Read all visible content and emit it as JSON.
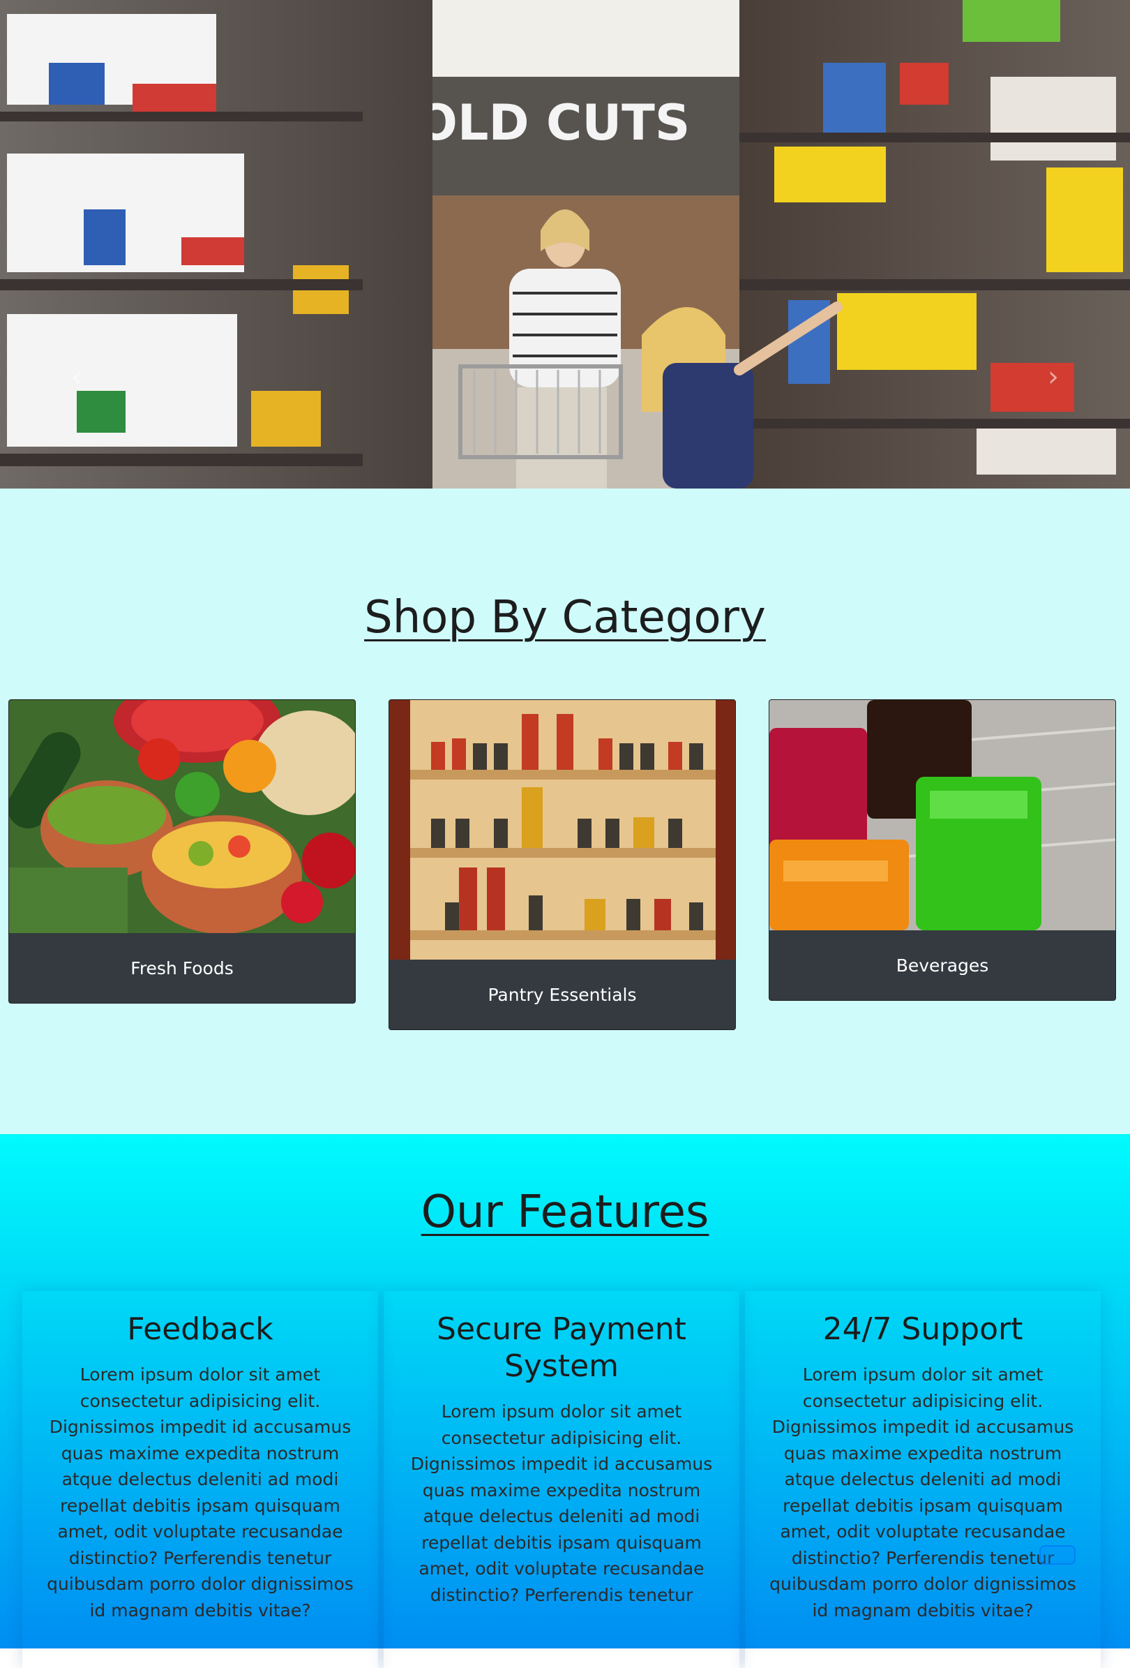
{
  "hero": {
    "prev_icon": "chevron-left-icon",
    "next_icon": "chevron-right-icon",
    "prev_glyph": "‹",
    "next_glyph": "›",
    "sign_text": "COLD CUTS"
  },
  "categories": {
    "heading": "Shop By Category",
    "cards": [
      {
        "label": "Fresh Foods"
      },
      {
        "label": "Pantry Essentials"
      },
      {
        "label": "Beverages"
      }
    ]
  },
  "features": {
    "heading": "Our Features",
    "items": [
      {
        "title": "Feedback",
        "body": "Lorem ipsum dolor sit amet consectetur adipisicing elit. Dignissimos impedit id accusamus quas maxime expedita nostrum atque delectus deleniti ad modi repellat debitis ipsam quisquam amet, odit voluptate recusandae distinctio? Perferendis tenetur quibusdam porro dolor dignissimos id magnam debitis vitae?"
      },
      {
        "title": "Secure Payment System",
        "body": "Lorem ipsum dolor sit amet consectetur adipisicing elit. Dignissimos impedit id accusamus quas maxime expedita nostrum atque delectus deleniti ad modi repellat debitis ipsam quisquam amet, odit voluptate recusandae distinctio? Perferendis tenetur"
      },
      {
        "title": "24/7 Support",
        "body": "Lorem ipsum dolor sit amet consectetur adipisicing elit. Dignissimos impedit id accusamus quas maxime expedita nostrum atque delectus deleniti ad modi repellat debitis ipsam quisquam amet, odit voluptate recusandae distinctio? Perferendis tenetur quibusdam porro dolor dignissimos id magnam debitis vitae?"
      }
    ]
  }
}
